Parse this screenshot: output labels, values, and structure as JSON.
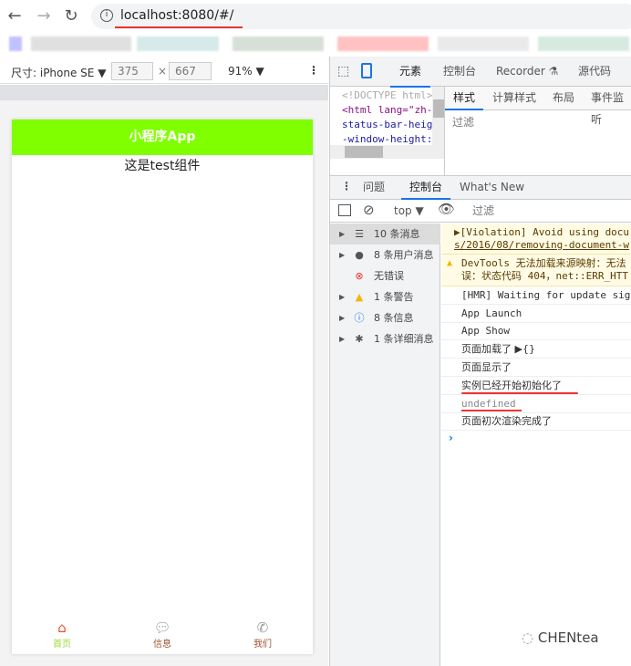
{
  "browser": {
    "back_icon": "arrow-left-icon",
    "forward_icon": "arrow-right-icon",
    "reload_icon": "reload-icon",
    "url": "localhost:8080/#/"
  },
  "device_toolbar": {
    "device": "尺寸: iPhone SE ▼",
    "width": "375",
    "times": "×",
    "height": "667",
    "zoom": "91% ▼",
    "more": "⋮"
  },
  "phone": {
    "title": "小程序App",
    "content": "这是test组件",
    "tabs": [
      {
        "label": "首页",
        "icon": "home-icon"
      },
      {
        "label": "信息",
        "icon": "message-icon"
      },
      {
        "label": "我们",
        "icon": "phone-icon"
      }
    ]
  },
  "devtools": {
    "tabs": [
      "元素",
      "控制台",
      "Recorder ⚗",
      "源代码"
    ],
    "dom_lines": [
      "<!DOCTYPE html>",
      "<html lang=\"zh-C",
      "status-bar-heig",
      "-window-height:"
    ],
    "styles_tabs": [
      "样式",
      "计算样式",
      "布局",
      "事件监听"
    ],
    "styles_filter": "过滤",
    "drawer_tabs": [
      "问题",
      "控制台",
      "What's New"
    ],
    "console_context": "top ▼",
    "console_filter": "过滤",
    "sidebar": [
      {
        "label": "10 条消息",
        "icon": "list-icon"
      },
      {
        "label": "8 条用户消息",
        "icon": "user-icon"
      },
      {
        "label": "无错误",
        "icon": "error-icon"
      },
      {
        "label": "1 条警告",
        "icon": "warning-icon"
      },
      {
        "label": "8 条信息",
        "icon": "info-icon"
      },
      {
        "label": "1 条详细消息",
        "icon": "bug-icon"
      }
    ],
    "messages": {
      "violation1": "▶[Violation] Avoid using docu",
      "violation2": "s/2016/08/removing-document-w",
      "warn1": "DevTools 无法加载来源映射：无法",
      "warn2": "误：状态代码 404，net::ERR_HTT",
      "log": [
        "[HMR] Waiting for update signa",
        "App Launch",
        "App Show",
        "页面加载了 ▶{}",
        "页面显示了",
        "实例已经开始初始化了",
        "undefined",
        "页面初次渲染完成了"
      ],
      "prompt": "›"
    }
  },
  "watermark": "CHENtea"
}
